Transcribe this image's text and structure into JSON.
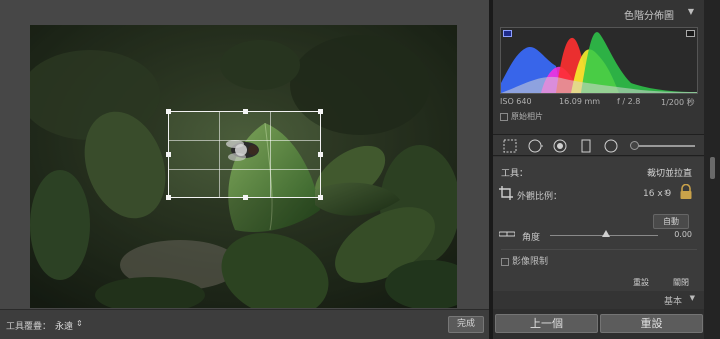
{
  "workspace": {
    "toolbar": {
      "overlay_label": "工具覆疊：",
      "overlay_value": "永遠",
      "done_label": "完成"
    }
  },
  "histogram": {
    "title": "色階分佈圖",
    "iso": "ISO 640",
    "focal": "16.09 mm",
    "aperture": "f / 2.8",
    "shutter": "1/200 秒",
    "original_photo_label": "原始相片"
  },
  "crop_tool": {
    "tool_label": "工具：",
    "tool_name": "裁切並拉直",
    "aspect_label": "外觀比例：",
    "aspect_value": "16 x 9",
    "auto_label": "自動",
    "angle_label": "角度",
    "angle_value": "0.00",
    "constrain_label": "影像限制",
    "reset_label": "重設",
    "close_label": "關閉"
  },
  "basic_panel": {
    "label": "基本"
  },
  "footer": {
    "previous_label": "上一個",
    "reset_label": "重設"
  },
  "colors": {
    "panel_bg": "#343434",
    "workspace_bg": "#474747",
    "histogram_blue": "#3a6cff",
    "histogram_magenta": "#ff2fe0",
    "histogram_red": "#ff3030",
    "histogram_yellow": "#f5ee2e",
    "histogram_green": "#2ec94a"
  }
}
